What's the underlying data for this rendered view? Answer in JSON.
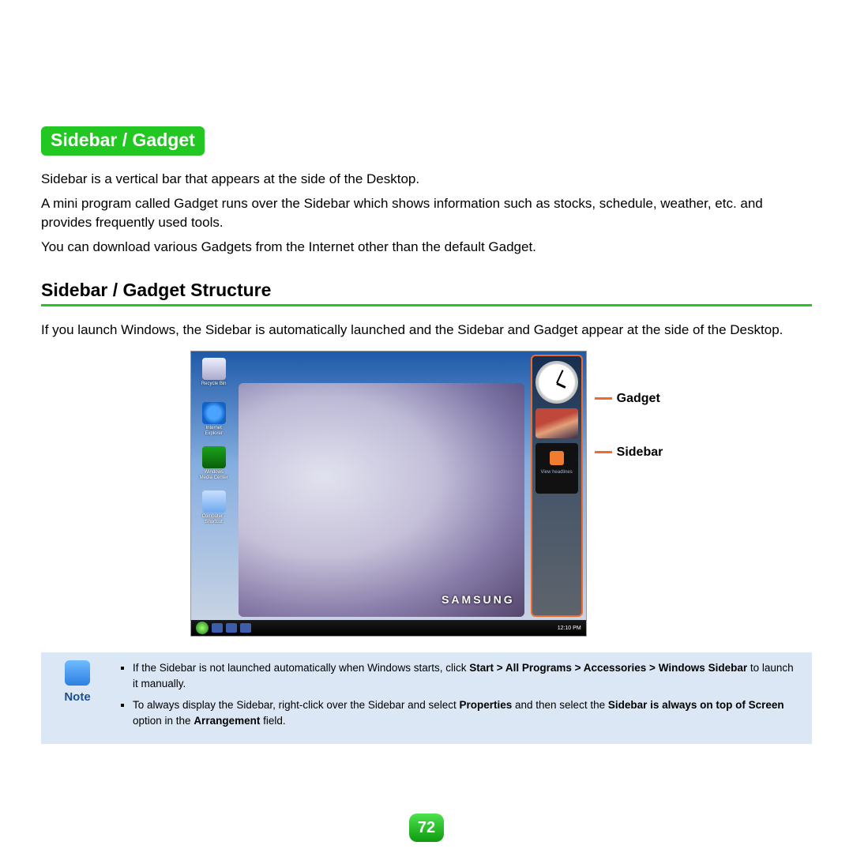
{
  "title": "Sidebar / Gadget",
  "intro": [
    "Sidebar is a vertical bar that appears at the side of the Desktop.",
    "A mini program called Gadget runs over the Sidebar which shows information such as stocks, schedule, weather, etc. and provides frequently used tools.",
    "You can download various Gadgets from the Internet other than the default Gadget."
  ],
  "section_heading": "Sidebar / Gadget Structure",
  "section_text": "If you launch Windows, the Sidebar is automatically launched and the Sidebar and Gadget appear at the side of the Desktop.",
  "screenshot": {
    "brand": "SAMSUNG",
    "taskbar_time": "12:10 PM",
    "desktop_icons": [
      "Recycle Bin",
      "Internet Explorer",
      "Windows Media Center",
      "Computer - Shortcut"
    ],
    "sidebar_gadgets": {
      "feed_label": "View headlines"
    }
  },
  "callouts": {
    "gadget": "Gadget",
    "sidebar": "Sidebar"
  },
  "note": {
    "label": "Note",
    "items": [
      {
        "pre": "If the Sidebar is not launched automatically when Windows starts, click ",
        "bold1": "Start > All Programs > Accessories > Windows Sidebar",
        "post1": " to launch it manually."
      },
      {
        "pre": "To always display the Sidebar, right-click over the Sidebar and select ",
        "bold1": "Properties",
        "mid": " and then select the ",
        "bold2": "Sidebar is always on top of Screen",
        "post1": " option in the ",
        "bold3": "Arrangement",
        "post2": " field."
      }
    ]
  },
  "page_number": "72"
}
